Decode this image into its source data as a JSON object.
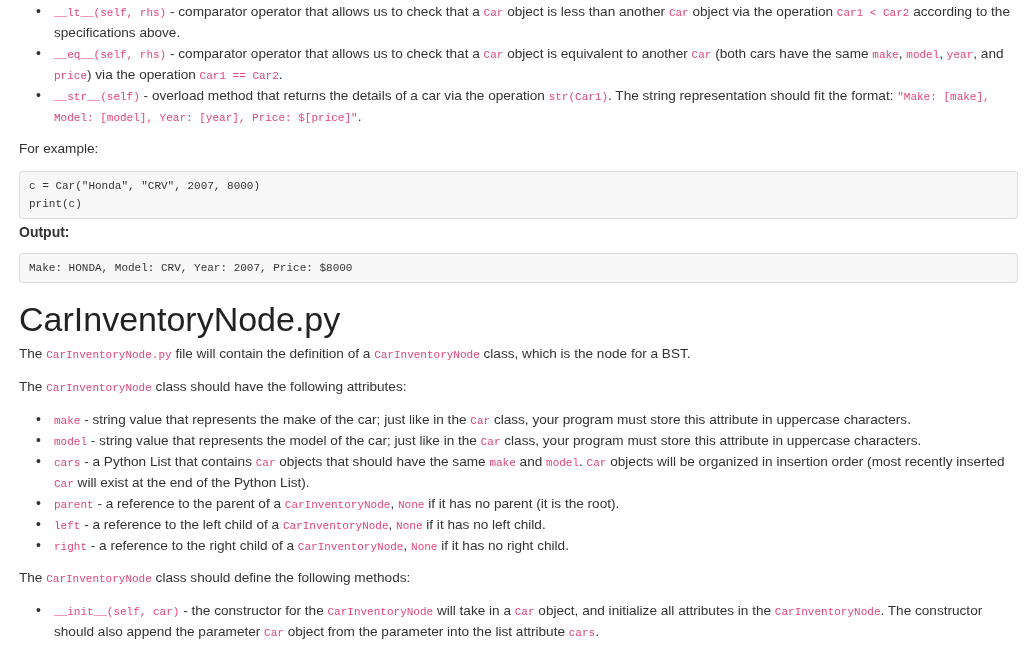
{
  "blocks": [
    {
      "kind": "bullets",
      "marker": "•",
      "items": [
        [
          {
            "code": "__lt__(self, rhs)"
          },
          " - comparator operator that allows us to check that a ",
          {
            "code": "Car"
          },
          " object is less than another ",
          {
            "code": "Car"
          },
          " object via the operation ",
          {
            "code": "Car1 < Car2"
          },
          " according to the specifications above."
        ],
        [
          {
            "code": "__eq__(self, rhs)"
          },
          " - comparator operator that allows us to check that a ",
          {
            "code": "Car"
          },
          " object is equivalent to another ",
          {
            "code": "Car"
          },
          " (both cars have the same ",
          {
            "code": "make"
          },
          ", ",
          {
            "code": "model"
          },
          ", ",
          {
            "code": "year"
          },
          ", and ",
          {
            "code": "price"
          },
          ") via the operation ",
          {
            "code": "Car1 == Car2"
          },
          "."
        ],
        [
          {
            "code": "__str__(self)"
          },
          " - overload method that returns the details of a car via the operation ",
          {
            "code": "str(Car1)"
          },
          ". The string representation should fit the format: ",
          {
            "code": "\"Make: [make], Model: [model], Year: [year], Price: $[price]\""
          },
          "."
        ]
      ]
    },
    {
      "kind": "paragraph",
      "parts": [
        "For example:"
      ]
    },
    {
      "kind": "code",
      "lines": [
        "c = Car(\"Honda\", \"CRV\", 2007, 8000)",
        "print(c)"
      ]
    },
    {
      "kind": "label",
      "text": "Output:"
    },
    {
      "kind": "code",
      "lines": [
        "Make: HONDA, Model: CRV, Year: 2007, Price: $8000"
      ]
    },
    {
      "kind": "heading",
      "text": "CarInventoryNode.py"
    },
    {
      "kind": "paragraph",
      "parts": [
        "The ",
        {
          "code": "CarInventoryNode.py"
        },
        " file will contain the definition of a ",
        {
          "code": "CarInventoryNode"
        },
        " class, which is the node for a BST."
      ]
    },
    {
      "kind": "paragraph",
      "parts": [
        "The ",
        {
          "code": "CarInventoryNode"
        },
        " class should have the following attributes:"
      ]
    },
    {
      "kind": "bullets",
      "marker": "•",
      "items": [
        [
          {
            "code": "make"
          },
          " - string value that represents the make of the car; just like in the ",
          {
            "code": "Car"
          },
          " class, your program must store this attribute in uppercase characters."
        ],
        [
          {
            "code": "model"
          },
          " - string value that represents the model of the car; just like in the ",
          {
            "code": "Car"
          },
          " class, your program must store this attribute in uppercase characters."
        ],
        [
          {
            "code": "cars"
          },
          " - a Python List that contains ",
          {
            "code": "Car"
          },
          " objects that should have the same ",
          {
            "code": "make"
          },
          " and ",
          {
            "code": "model"
          },
          ". ",
          {
            "code": "Car"
          },
          " objects will be organized in insertion order (most recently inserted ",
          {
            "code": "Car"
          },
          " will exist at the end of the Python List)."
        ],
        [
          {
            "code": "parent"
          },
          " - a reference to the parent of a ",
          {
            "code": "CarInventoryNode"
          },
          ", ",
          {
            "code": "None"
          },
          " if it has no parent (it is the root)."
        ],
        [
          {
            "code": "left"
          },
          " - a reference to the left child of a ",
          {
            "code": "CarInventoryNode"
          },
          ", ",
          {
            "code": "None"
          },
          " if it has no left child."
        ],
        [
          {
            "code": "right"
          },
          " - a reference to the right child of a ",
          {
            "code": "CarInventoryNode"
          },
          ", ",
          {
            "code": "None"
          },
          " if it has no right child."
        ]
      ]
    },
    {
      "kind": "paragraph",
      "parts": [
        "The ",
        {
          "code": "CarInventoryNode"
        },
        " class should define the following methods:"
      ]
    },
    {
      "kind": "bullets",
      "marker": "•",
      "items": [
        [
          {
            "code": "__init__(self, car)"
          },
          " - the constructor for the ",
          {
            "code": "CarInventoryNode"
          },
          " will take in a ",
          {
            "code": "Car"
          },
          " object, and initialize all attributes in the ",
          {
            "code": "CarInventoryNode"
          },
          ". The constructor should also append the parameter ",
          {
            "code": "Car"
          },
          " object from the parameter into the list attribute ",
          {
            "code": "cars"
          },
          "."
        ]
      ]
    }
  ]
}
